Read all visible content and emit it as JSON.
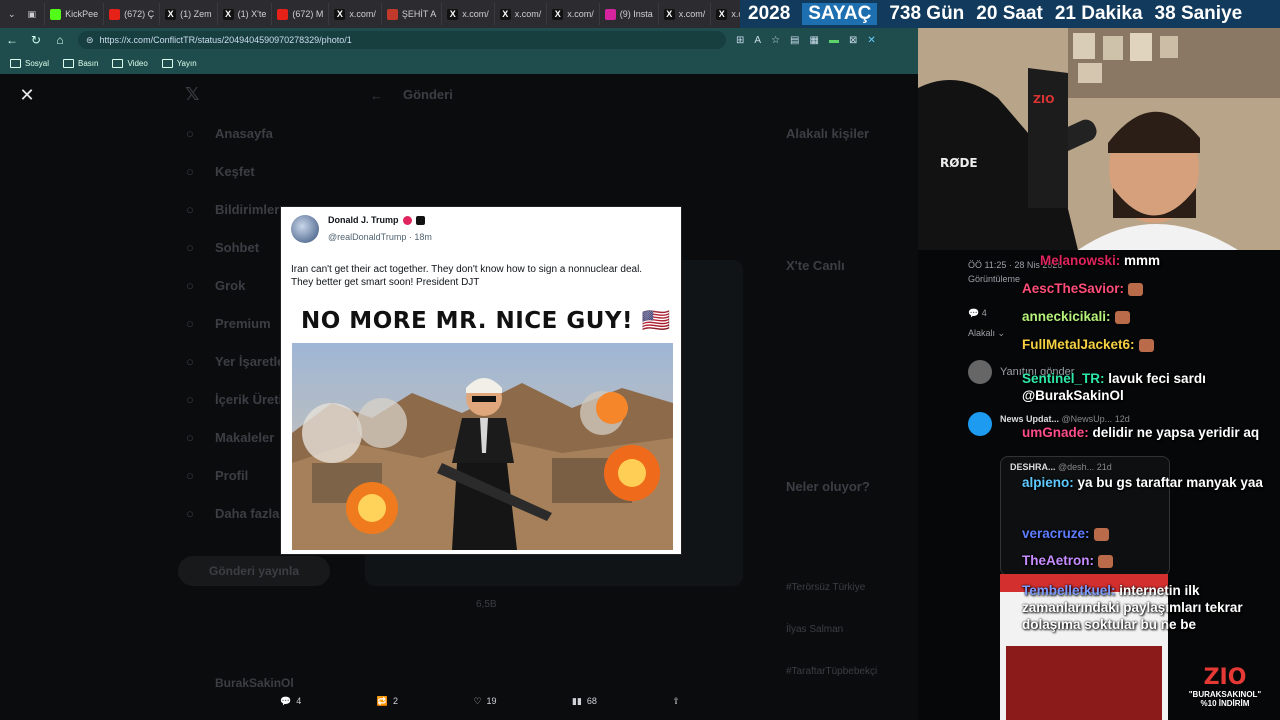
{
  "browser": {
    "tabs": [
      {
        "label": "KickPee",
        "icon": "kick"
      },
      {
        "label": "(672) Ç",
        "icon": "yt"
      },
      {
        "label": "(1) Zem",
        "icon": "x"
      },
      {
        "label": "(1) X'te",
        "icon": "x"
      },
      {
        "label": "(672) M",
        "icon": "yt"
      },
      {
        "label": "x.com/",
        "icon": "x"
      },
      {
        "label": "ŞEHİT A",
        "icon": "red"
      },
      {
        "label": "x.com/",
        "icon": "x"
      },
      {
        "label": "x.com/",
        "icon": "x"
      },
      {
        "label": "x.com/",
        "icon": "x"
      },
      {
        "label": "(9) Insta",
        "icon": "ig"
      },
      {
        "label": "x.com/",
        "icon": "x"
      },
      {
        "label": "x.com/",
        "icon": "x"
      },
      {
        "label": "x.com/",
        "icon": "x"
      },
      {
        "label": "x.com",
        "icon": "x"
      }
    ],
    "url": "https://x.com/ConflictTR/status/2049404590970278329/photo/1",
    "bookmarks": [
      "Sosyal",
      "Basın",
      "Video",
      "Yayın"
    ]
  },
  "banner": {
    "year": "2028",
    "label": "SAYAÇ",
    "days": "738 Gün",
    "hours": "20 Saat",
    "minutes": "21 Dakika",
    "seconds": "38 Saniye"
  },
  "background_page": {
    "nav_items": [
      "Anasayfa",
      "Keşfet",
      "Bildirimler",
      "Sohbet",
      "Grok",
      "Premium",
      "Yer İşaretleri",
      "İçerik Üretici",
      "Makaleler",
      "Profil",
      "Daha fazla"
    ],
    "post_button": "Gönderi yayınla",
    "header": "Gönderi",
    "right_headings": [
      "Alakalı kişiler",
      "X'te Canlı",
      "Neler oluyor?"
    ],
    "account": "BurakSakinOl",
    "views": "6,5B",
    "trends": [
      "#Terörsüz Türkiye",
      "İlyas Salman",
      "#TaraftarTüpbebekçi"
    ]
  },
  "image_card": {
    "author_name": "Donald J. Trump",
    "author_handle": "@realDonaldTrump",
    "time": "18m",
    "text": "Iran can't get their act together. They don't know how to sign a nonnuclear deal. They better get smart soon! President DJT",
    "headline": "NO MORE MR. NICE GUY! 🇺🇸"
  },
  "actions": {
    "replies": "4",
    "reposts": "2",
    "likes": "19",
    "views": "68"
  },
  "chat": {
    "timestamp": "ÖÖ 11:25 · 28 Nis 2026",
    "views_label": "Görüntüleme",
    "sort_label": "Alakalı",
    "reply_placeholder": "Yanıtını gönder",
    "news_name": "News Updat...",
    "news_handle": "@NewsUp...",
    "news_time": "12d",
    "deshra_name": "DESHRA...",
    "deshra_handle": "@desh...",
    "deshra_time": "21d",
    "messages": [
      {
        "user": "Melanowski:",
        "text": "mmm",
        "color": "#e0245e"
      },
      {
        "user": "AescTheSavior:",
        "text": "",
        "color": "#ff4d7a"
      },
      {
        "user": "anneckicikali:",
        "text": "",
        "color": "#b6f27a"
      },
      {
        "user": "FullMetalJacket6:",
        "text": "",
        "color": "#f5d142"
      },
      {
        "user": "Sentinel_TR:",
        "text": "lavuk feci sardı @BurakSakinOl",
        "color": "#2ee8a8"
      },
      {
        "user": "umGnade:",
        "text": "delidir ne yapsa yeridir aq",
        "color": "#ff4d8a"
      },
      {
        "user": "alpieno:",
        "text": "ya bu gs taraftar manyak yaa",
        "color": "#5fc9ff"
      },
      {
        "user": "veracruze:",
        "text": "",
        "color": "#5f7cff"
      },
      {
        "user": "TheAetron:",
        "text": "",
        "color": "#c68cff"
      },
      {
        "user": "Tembelletkuel:",
        "text": "internetin ilk zamanlarındaki paylaşımları tekrar dolaşıma soktular bu ne be",
        "color": "#7d9cff"
      }
    ]
  },
  "sponsor": {
    "brand": "ZIO",
    "code": "\"BURAKSAKINOL\"",
    "discount": "%10 İNDİRİM"
  },
  "colors": {
    "banner_bg": "#113a5c",
    "browser_bar": "#1f4d4d",
    "accent": "#1d9bf0"
  }
}
